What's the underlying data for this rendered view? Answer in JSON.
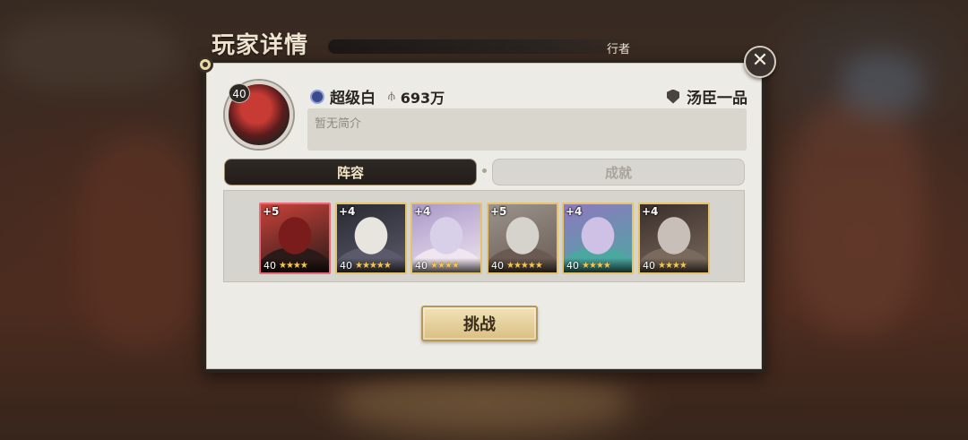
{
  "header": {
    "title": "玩家详情",
    "bar_text": "行者",
    "close_glyph": "✕"
  },
  "player": {
    "level": "40",
    "name": "超级白",
    "power": "693万",
    "rank_title": "汤臣一品",
    "bio_placeholder": "暂无简介"
  },
  "tabs": [
    {
      "label": "阵容",
      "active": true
    },
    {
      "label": "成就",
      "active": false
    }
  ],
  "lineup": [
    {
      "plus": "+5",
      "level": "40",
      "stars": "★★★★",
      "frame": "red",
      "colors": [
        "#7a1c1c",
        "#c8423a",
        "#2a1a18"
      ]
    },
    {
      "plus": "+4",
      "level": "40",
      "stars": "★★★★★",
      "frame": "gold",
      "colors": [
        "#e8e4de",
        "#2a2a33",
        "#5a5a6a"
      ]
    },
    {
      "plus": "+4",
      "level": "40",
      "stars": "★★★★",
      "frame": "gold",
      "colors": [
        "#d8d0e8",
        "#a998c8",
        "#f0e6f0"
      ]
    },
    {
      "plus": "+5",
      "level": "40",
      "stars": "★★★★★",
      "frame": "gold",
      "colors": [
        "#d6d2cc",
        "#9a948c",
        "#6a5a52"
      ]
    },
    {
      "plus": "+4",
      "level": "40",
      "stars": "★★★★",
      "frame": "gold",
      "colors": [
        "#cfc0e6",
        "#8f78c0",
        "#4aa8a0"
      ]
    },
    {
      "plus": "+4",
      "level": "40",
      "stars": "★★★★",
      "frame": "gold",
      "colors": [
        "#c8c0b8",
        "#3a2e2a",
        "#7a6a5e"
      ]
    }
  ],
  "action": {
    "challenge_label": "挑战"
  },
  "colors": {
    "panel_bg": "#ecebe6",
    "accent_gold": "#d9bf83",
    "tab_active": "#2f2925"
  }
}
